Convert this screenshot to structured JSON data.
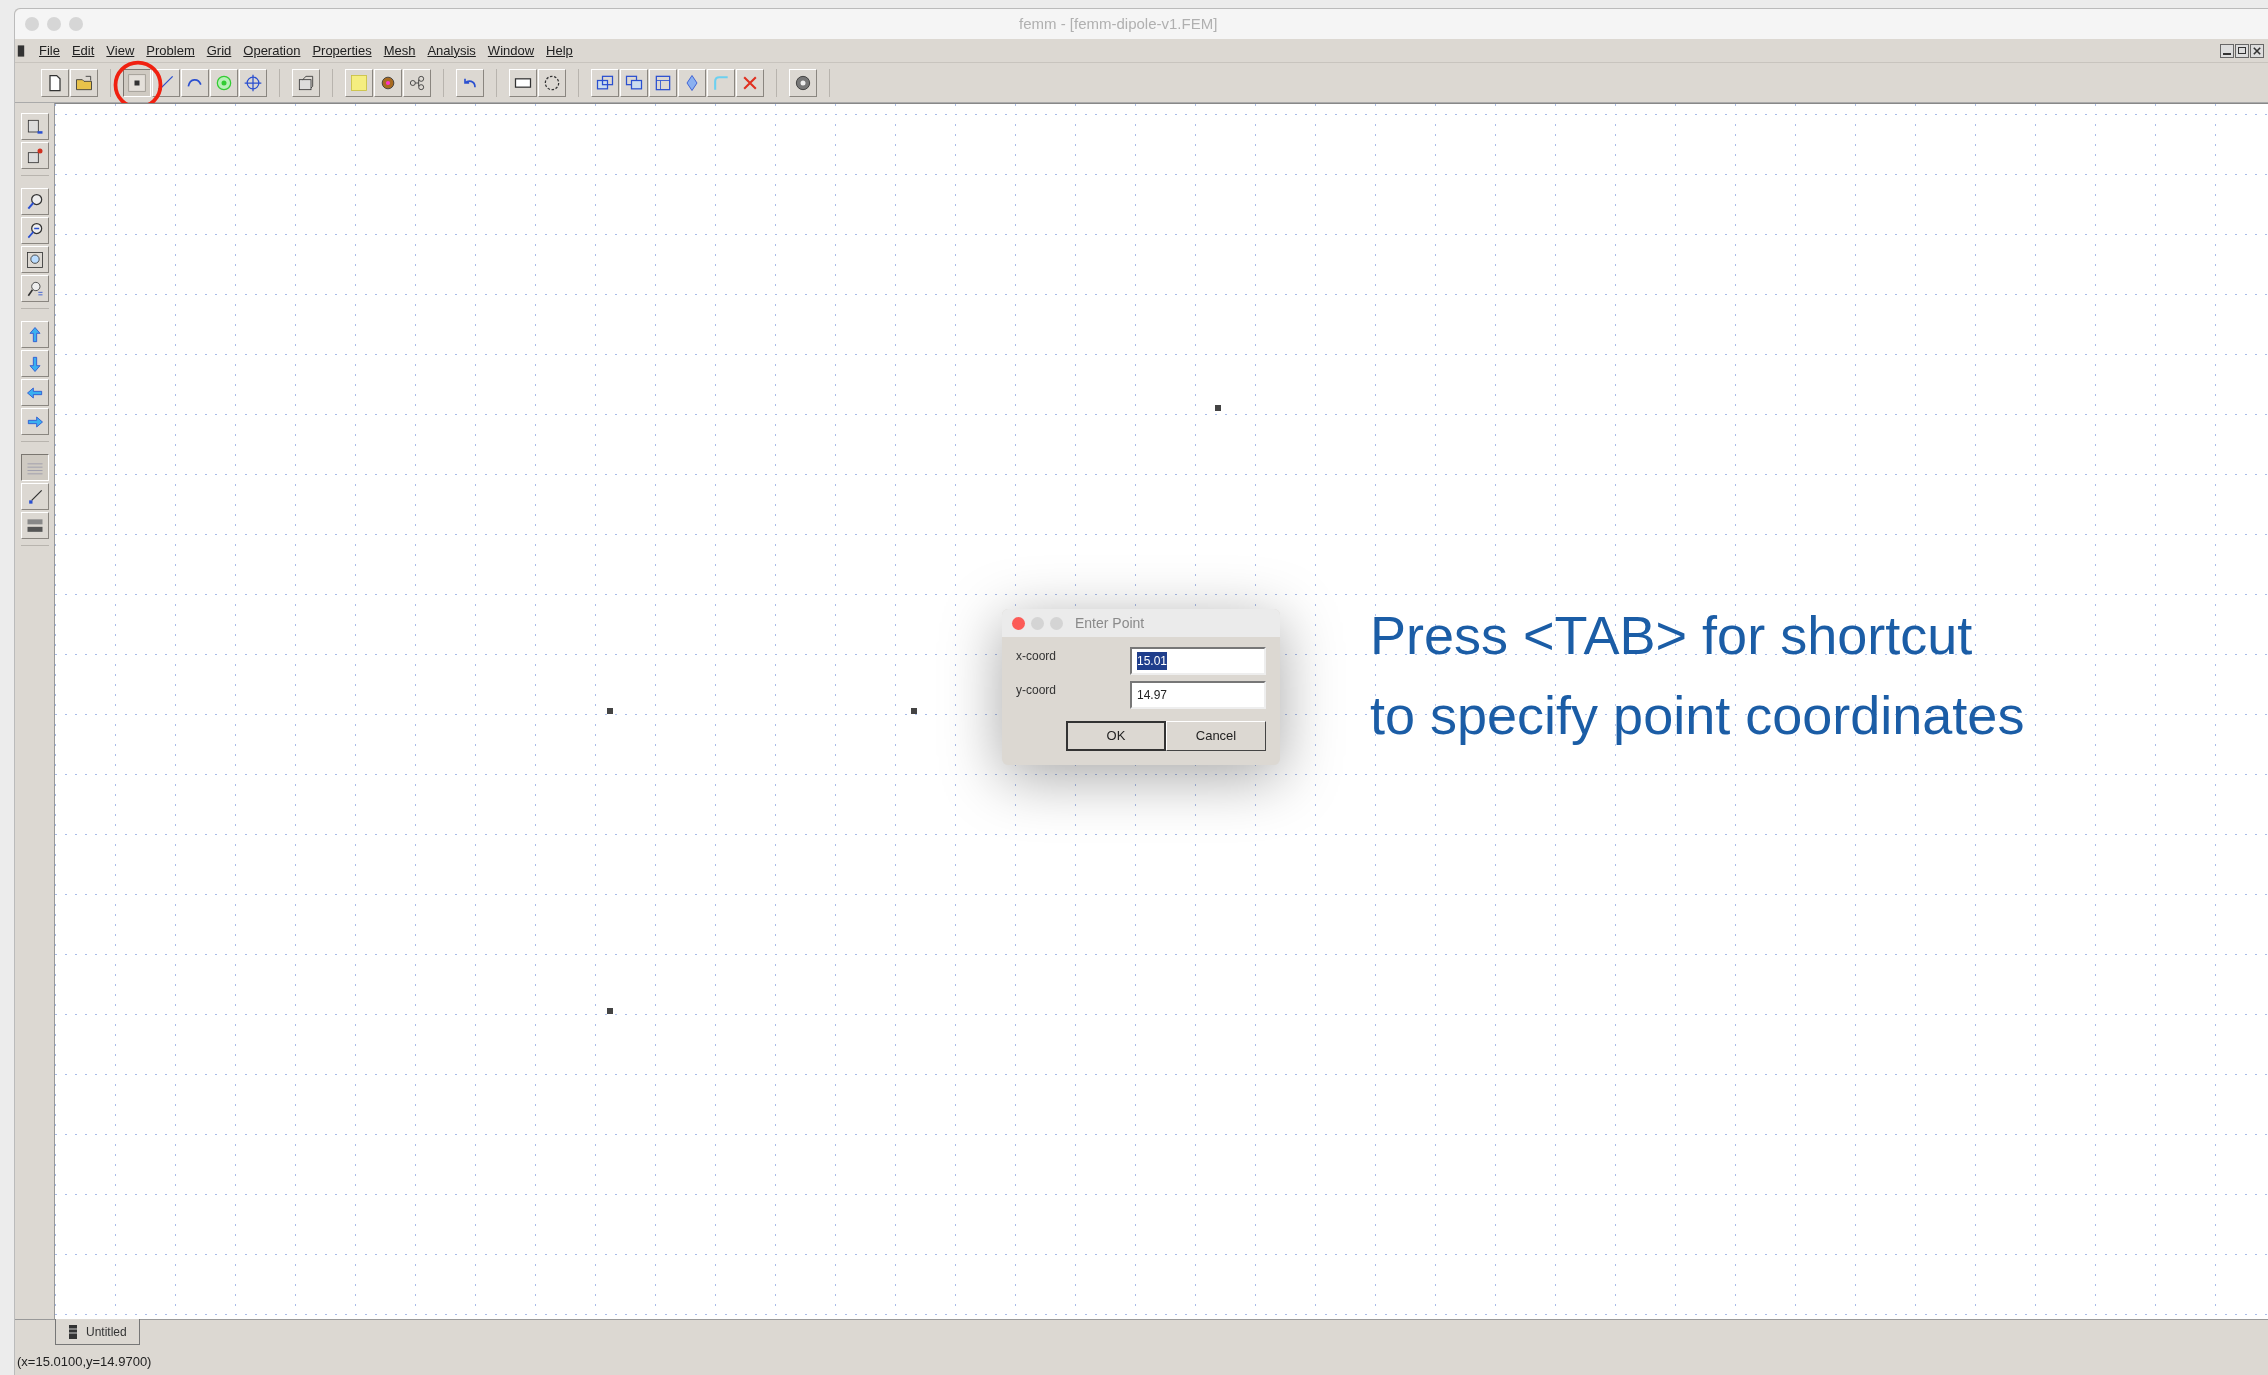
{
  "window": {
    "title": "femm - [femm-dipole-v1.FEM]"
  },
  "menu": [
    "File",
    "Edit",
    "View",
    "Problem",
    "Grid",
    "Operation",
    "Properties",
    "Mesh",
    "Analysis",
    "Window",
    "Help"
  ],
  "toolbar": [
    [
      {
        "selected": false
      },
      {
        "selected": false
      }
    ],
    [
      {
        "selected": true
      },
      {
        "selected": false
      },
      {
        "selected": false
      },
      {
        "selected": false
      },
      {
        "selected": false
      }
    ],
    [
      {
        "selected": false
      }
    ],
    [
      {
        "selected": false
      },
      {
        "selected": false
      },
      {
        "selected": false
      }
    ],
    [
      {
        "selected": false
      }
    ],
    [
      {
        "selected": false
      },
      {
        "selected": false
      }
    ],
    [
      {
        "selected": false
      },
      {
        "selected": false
      },
      {
        "selected": false
      },
      {
        "selected": false
      },
      {
        "selected": false
      },
      {
        "selected": false
      }
    ],
    [
      {
        "selected": false
      }
    ]
  ],
  "side_toolbar": [
    [
      {
        "selected": false
      },
      {
        "selected": false
      }
    ],
    [
      {
        "selected": false
      },
      {
        "selected": false
      },
      {
        "selected": false
      },
      {
        "selected": false
      }
    ],
    [
      {
        "selected": false
      },
      {
        "selected": false
      },
      {
        "selected": false
      },
      {
        "selected": false
      }
    ],
    [
      {
        "selected": true
      },
      {
        "selected": false
      },
      {
        "selected": false
      }
    ]
  ],
  "dialog": {
    "title": "Enter Point",
    "fields": [
      {
        "label": "x-coord",
        "value": "15.01",
        "selected": true
      },
      {
        "label": "y-coord",
        "value": "14.97",
        "selected": false
      }
    ],
    "buttons": [
      {
        "label": "OK",
        "default": true
      },
      {
        "label": "Cancel",
        "default": false
      }
    ]
  },
  "callout": [
    "Press <TAB> for shortcut",
    "to specify point coordinates"
  ],
  "tabs": [
    {
      "label": "Untitled"
    }
  ],
  "status_bar": "(x=15.0100,y=14.9700)"
}
